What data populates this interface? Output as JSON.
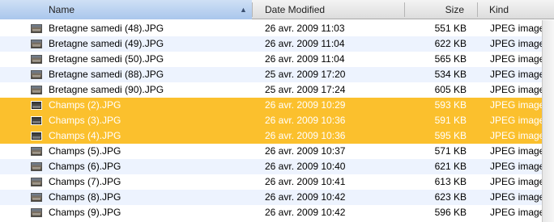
{
  "columns": {
    "name": "Name",
    "date": "Date Modified",
    "size": "Size",
    "kind": "Kind",
    "sort_indicator": "▲"
  },
  "rows": [
    {
      "name": "Bretagne samedi (48).JPG",
      "date": "26 avr. 2009 11:03",
      "size": "551 KB",
      "kind": "JPEG image",
      "selected": false
    },
    {
      "name": "Bretagne samedi (49).JPG",
      "date": "26 avr. 2009 11:04",
      "size": "622 KB",
      "kind": "JPEG image",
      "selected": false
    },
    {
      "name": "Bretagne samedi (50).JPG",
      "date": "26 avr. 2009 11:04",
      "size": "565 KB",
      "kind": "JPEG image",
      "selected": false
    },
    {
      "name": "Bretagne samedi (88).JPG",
      "date": "25 avr. 2009 17:20",
      "size": "534 KB",
      "kind": "JPEG image",
      "selected": false
    },
    {
      "name": "Bretagne samedi (90).JPG",
      "date": "25 avr. 2009 17:24",
      "size": "605 KB",
      "kind": "JPEG image",
      "selected": false
    },
    {
      "name": "Champs (2).JPG",
      "date": "26 avr. 2009 10:29",
      "size": "593 KB",
      "kind": "JPEG image",
      "selected": true
    },
    {
      "name": "Champs (3).JPG",
      "date": "26 avr. 2009 10:36",
      "size": "591 KB",
      "kind": "JPEG image",
      "selected": true
    },
    {
      "name": "Champs (4).JPG",
      "date": "26 avr. 2009 10:36",
      "size": "595 KB",
      "kind": "JPEG image",
      "selected": true
    },
    {
      "name": "Champs (5).JPG",
      "date": "26 avr. 2009 10:37",
      "size": "571 KB",
      "kind": "JPEG image",
      "selected": false
    },
    {
      "name": "Champs (6).JPG",
      "date": "26 avr. 2009 10:40",
      "size": "621 KB",
      "kind": "JPEG image",
      "selected": false
    },
    {
      "name": "Champs (7).JPG",
      "date": "26 avr. 2009 10:41",
      "size": "613 KB",
      "kind": "JPEG image",
      "selected": false
    },
    {
      "name": "Champs (8).JPG",
      "date": "26 avr. 2009 10:42",
      "size": "623 KB",
      "kind": "JPEG image",
      "selected": false
    },
    {
      "name": "Champs (9).JPG",
      "date": "26 avr. 2009 10:42",
      "size": "596 KB",
      "kind": "JPEG image",
      "selected": false
    }
  ],
  "file_icon": "image-thumbnail-icon",
  "colors": {
    "selection": "#fbc02d",
    "alternate_row": "#edf3fe",
    "sorted_header": "#a9c6ec"
  }
}
